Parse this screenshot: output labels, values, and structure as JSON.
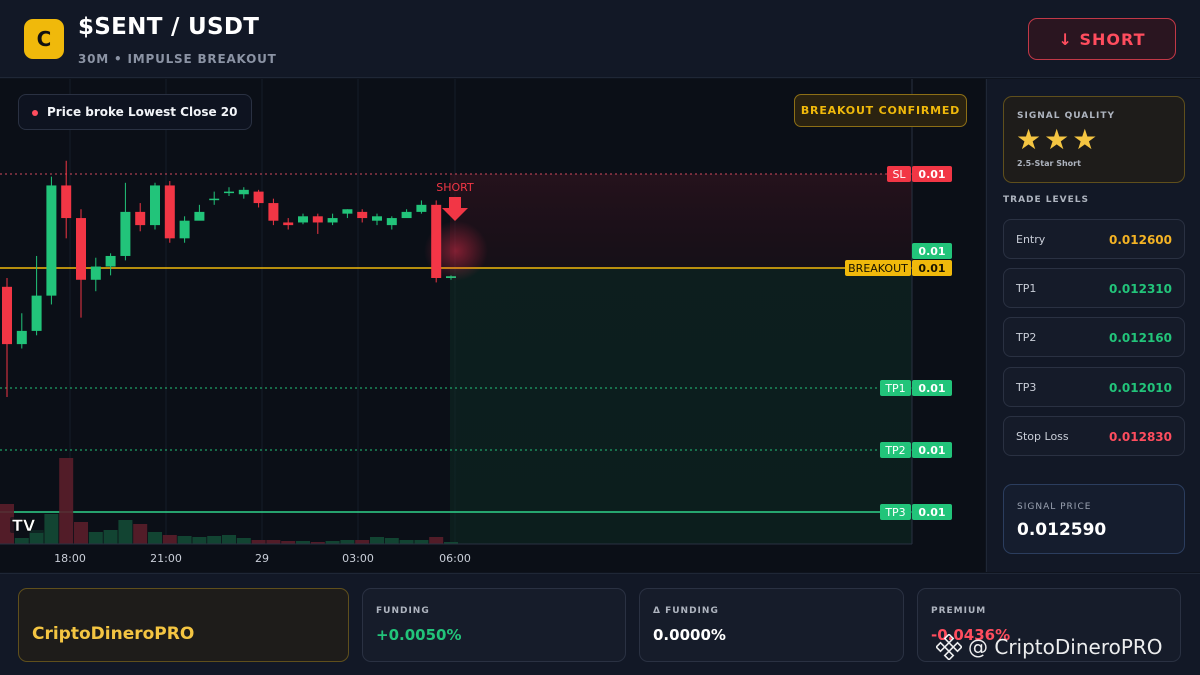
{
  "header": {
    "logo_letter": "C",
    "title": "$SENT / USDT",
    "subtitle": "30M • IMPULSE BREAKOUT",
    "short_button": "↓ SHORT"
  },
  "chart": {
    "note": "Price broke Lowest Close 20",
    "confirm_badge": "BREAKOUT CONFIRMED",
    "signal_marker": "SHORT",
    "watermark_logo": "TV",
    "time_labels": [
      "18:00",
      "21:00",
      "29",
      "03:00",
      "06:00"
    ],
    "level_tags": [
      {
        "name": "SL",
        "value": "0.01",
        "color": "#f23645"
      },
      {
        "name": "",
        "value": "0.01",
        "color": "#22c47a"
      },
      {
        "name": "BREAKOUT",
        "value": "0.01",
        "color": "#f0b90b"
      },
      {
        "name": "TP1",
        "value": "0.01",
        "color": "#22c47a"
      },
      {
        "name": "TP2",
        "value": "0.01",
        "color": "#22c47a"
      },
      {
        "name": "TP3",
        "value": "0.01",
        "color": "#22c47a"
      }
    ],
    "candles": [
      {
        "o": 0.012595,
        "h": 0.012605,
        "l": 0.01247,
        "c": 0.01253
      },
      {
        "o": 0.01253,
        "h": 0.012565,
        "l": 0.012525,
        "c": 0.012545
      },
      {
        "o": 0.012545,
        "h": 0.01263,
        "l": 0.01254,
        "c": 0.012585
      },
      {
        "o": 0.012585,
        "h": 0.01272,
        "l": 0.012575,
        "c": 0.01271
      },
      {
        "o": 0.01271,
        "h": 0.012738,
        "l": 0.01265,
        "c": 0.012673
      },
      {
        "o": 0.012673,
        "h": 0.012683,
        "l": 0.01256,
        "c": 0.012603
      },
      {
        "o": 0.012603,
        "h": 0.012628,
        "l": 0.01259,
        "c": 0.012618
      },
      {
        "o": 0.012618,
        "h": 0.012633,
        "l": 0.012608,
        "c": 0.01263
      },
      {
        "o": 0.01263,
        "h": 0.012713,
        "l": 0.012625,
        "c": 0.01268
      },
      {
        "o": 0.01268,
        "h": 0.01269,
        "l": 0.012658,
        "c": 0.012665
      },
      {
        "o": 0.012665,
        "h": 0.012713,
        "l": 0.01266,
        "c": 0.01271
      },
      {
        "o": 0.01271,
        "h": 0.012715,
        "l": 0.012645,
        "c": 0.01265
      },
      {
        "o": 0.01265,
        "h": 0.012675,
        "l": 0.012645,
        "c": 0.01267
      },
      {
        "o": 0.01267,
        "h": 0.012688,
        "l": 0.012673,
        "c": 0.01268
      },
      {
        "o": 0.012695,
        "h": 0.012703,
        "l": 0.012688,
        "c": 0.012695
      },
      {
        "o": 0.012703,
        "h": 0.012708,
        "l": 0.012698,
        "c": 0.012703
      },
      {
        "o": 0.0127,
        "h": 0.012708,
        "l": 0.012695,
        "c": 0.012705
      },
      {
        "o": 0.012703,
        "h": 0.012705,
        "l": 0.012685,
        "c": 0.01269
      },
      {
        "o": 0.01269,
        "h": 0.012695,
        "l": 0.012665,
        "c": 0.01267
      },
      {
        "o": 0.012668,
        "h": 0.012673,
        "l": 0.01266,
        "c": 0.012665
      },
      {
        "o": 0.012668,
        "h": 0.012678,
        "l": 0.012666,
        "c": 0.012675
      },
      {
        "o": 0.012675,
        "h": 0.012678,
        "l": 0.012655,
        "c": 0.012668
      },
      {
        "o": 0.012668,
        "h": 0.012678,
        "l": 0.012665,
        "c": 0.012673
      },
      {
        "o": 0.012678,
        "h": 0.012683,
        "l": 0.012673,
        "c": 0.012683
      },
      {
        "o": 0.01268,
        "h": 0.012683,
        "l": 0.012668,
        "c": 0.012673
      },
      {
        "o": 0.01267,
        "h": 0.012678,
        "l": 0.012665,
        "c": 0.012675
      },
      {
        "o": 0.012665,
        "h": 0.012675,
        "l": 0.01266,
        "c": 0.012673
      },
      {
        "o": 0.012673,
        "h": 0.012683,
        "l": 0.012675,
        "c": 0.01268
      },
      {
        "o": 0.01268,
        "h": 0.012693,
        "l": 0.012678,
        "c": 0.012688
      },
      {
        "o": 0.012688,
        "h": 0.012693,
        "l": 0.0126,
        "c": 0.012605
      },
      {
        "o": 0.012605,
        "h": 0.012608,
        "l": 0.012603,
        "c": 0.012607
      }
    ],
    "volumes": [
      40,
      6,
      14,
      30,
      86,
      22,
      12,
      14,
      24,
      20,
      12,
      9,
      8,
      7,
      8,
      9,
      6,
      4,
      4,
      3,
      3,
      2,
      3,
      4,
      4,
      7,
      6,
      4,
      4,
      7,
      2
    ]
  },
  "panel": {
    "quality_title": "SIGNAL QUALITY",
    "quality_stars": "★★★",
    "quality_sub": "2.5-Star Short",
    "levels_title": "TRADE LEVELS",
    "levels": [
      {
        "label": "Entry",
        "value": "0.012600",
        "color": "#f4b324"
      },
      {
        "label": "TP1",
        "value": "0.012310",
        "color": "#22c47a"
      },
      {
        "label": "TP2",
        "value": "0.012160",
        "color": "#22c47a"
      },
      {
        "label": "TP3",
        "value": "0.012010",
        "color": "#22c47a"
      },
      {
        "label": "Stop Loss",
        "value": "0.012830",
        "color": "#ff4d5e"
      }
    ],
    "signal_label": "SIGNAL PRICE",
    "signal_value": "0.012590"
  },
  "footer": {
    "brand": "CriptoDineroPRO",
    "funding_label": "FUNDING",
    "funding_value": "+0.0050%",
    "dfunding_label": "Δ FUNDING",
    "dfunding_value": "0.0000%",
    "premium_label": "PREMIUM",
    "premium_value": "-0.0436%",
    "watermark": "@ CriptoDineroPRO"
  },
  "colors": {
    "up": "#22c47a",
    "down": "#f23645",
    "breakout": "#f0b90b"
  }
}
